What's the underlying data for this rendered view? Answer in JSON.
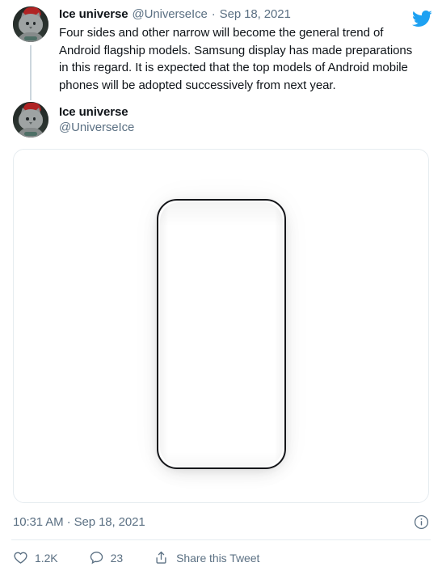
{
  "platform": {
    "name": "Twitter",
    "brand_color": "#1DA1F2",
    "logo_icon": "twitter-bird-icon"
  },
  "parent_tweet": {
    "avatar_icon": "cat-avatar",
    "display_name": "Ice universe",
    "handle": "@UniverseIce",
    "separator": "·",
    "date": "Sep 18, 2021",
    "text": "Four sides and other narrow will become the general trend of Android flagship models. Samsung display has made preparations in this regard. It is expected that the top models of Android mobile phones will be adopted successively from next year."
  },
  "main_tweet": {
    "avatar_icon": "cat-avatar",
    "display_name": "Ice universe",
    "handle": "@UniverseIce",
    "media": {
      "icon": "smartphone-outline-image",
      "description": "Smartphone front outline with narrow bezels"
    },
    "timestamp": "10:31 AM · Sep 18, 2021",
    "info_icon": "info-circle-icon",
    "actions": {
      "likes": {
        "icon": "heart-icon",
        "count": "1.2K"
      },
      "replies": {
        "icon": "reply-bubble-icon",
        "count": "23"
      },
      "share": {
        "icon": "share-icon",
        "label": "Share this Tweet"
      }
    }
  }
}
